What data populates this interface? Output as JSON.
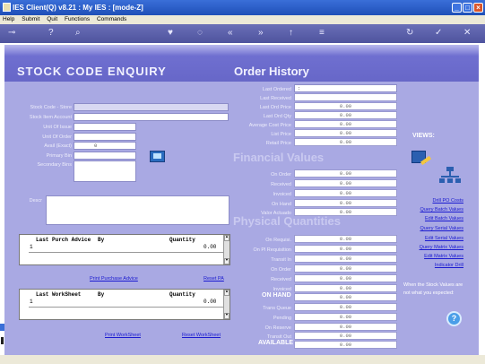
{
  "window": {
    "title": "IES Client(Q) v8.21 : My IES :     [mode-Z]"
  },
  "menu": [
    "Help",
    "Submit",
    "Quit",
    "Functions",
    "Commands"
  ],
  "header": {
    "left_title": "STOCK   CODE   ENQUIRY",
    "right_title": "Order History"
  },
  "left_fields": {
    "stock_code_store": {
      "label": "Stock Code - Store",
      "value": ""
    },
    "stock_item_account": {
      "label": "Stock Item Account",
      "value": ""
    },
    "unit_of_issue": {
      "label": "Unit Of Issue",
      "value": ""
    },
    "unit_of_order": {
      "label": "Unit Of Order",
      "value": ""
    },
    "avail_exact": {
      "label": "Avail (Exact)",
      "value": "0"
    },
    "primary_bin": {
      "label": "Primary Bin",
      "value": ""
    },
    "secondary_bins": {
      "label": "Secondary Bins",
      "value": ""
    },
    "descr": {
      "label": "Descr",
      "value": ""
    }
  },
  "order_history": {
    "rows": [
      {
        "label": "Last Ordered",
        "value": ""
      },
      {
        "label": "Last Received",
        "value": ""
      },
      {
        "label": "Last Ord Price",
        "value": "0.00"
      },
      {
        "label": "Last Ord Qty",
        "value": "0.00"
      },
      {
        "label": "Average Cost Price",
        "value": "0.00"
      },
      {
        "label": "List Price",
        "value": "0.00"
      },
      {
        "label": "Retail Price",
        "value": "0.00"
      }
    ]
  },
  "financial": {
    "title": "Financial Values",
    "rows": [
      {
        "label": "On Order",
        "value": "0.00"
      },
      {
        "label": "Received",
        "value": "0.00"
      },
      {
        "label": "Invoiced",
        "value": "0.00"
      },
      {
        "label": "On Hand",
        "value": "0.00"
      },
      {
        "label": "Valor Actuado",
        "value": "0.00"
      }
    ]
  },
  "physical": {
    "title": "Physical Quantities",
    "rows": [
      {
        "label": "On Requisi.",
        "value": "0.00"
      },
      {
        "label": "On Pl Requisition",
        "value": "0.00"
      },
      {
        "label": "Transit In",
        "value": "0.00"
      },
      {
        "label": "On Order",
        "value": "0.00"
      },
      {
        "label": "Received",
        "value": "0.00"
      },
      {
        "label": "Invoiced",
        "value": "0.00"
      },
      {
        "label": "ON HAND",
        "value": "0.00"
      },
      {
        "label": "Trans Queue",
        "value": "0.00"
      },
      {
        "label": "Pending",
        "value": "0.00"
      },
      {
        "label": "On Reserve",
        "value": "0.00"
      },
      {
        "label": "Transit Out",
        "value": "0.00"
      },
      {
        "label": "AVAILABLE",
        "value": "0.00"
      }
    ]
  },
  "purch_grid": {
    "col1": "Last Purch Advice",
    "col2": "By",
    "col3": "Quantity",
    "row_num": "1",
    "row_qty": "0.00"
  },
  "work_grid": {
    "col1": "Last WorkSheet",
    "col2": "By",
    "col3": "Quantity",
    "row_num": "1",
    "row_qty": "0.00"
  },
  "links": {
    "print_purchase_advice": "Print Purchase Advice",
    "reset_pa": "Reset PA",
    "print_worksheet": "Print WorkSheet",
    "reset_worksheet": "Reset WorkSheet"
  },
  "views": {
    "title": "VIEWS:",
    "items": [
      "Drill PO Costs",
      "Query Batch Values",
      "Edit Batch Values",
      "Query Serial Values",
      "Edit Serial Values",
      "Query Matrix Values",
      "Edit Matrix Values",
      "Indicator Drill"
    ],
    "note": "When the Stock Values are not what you expected:"
  }
}
